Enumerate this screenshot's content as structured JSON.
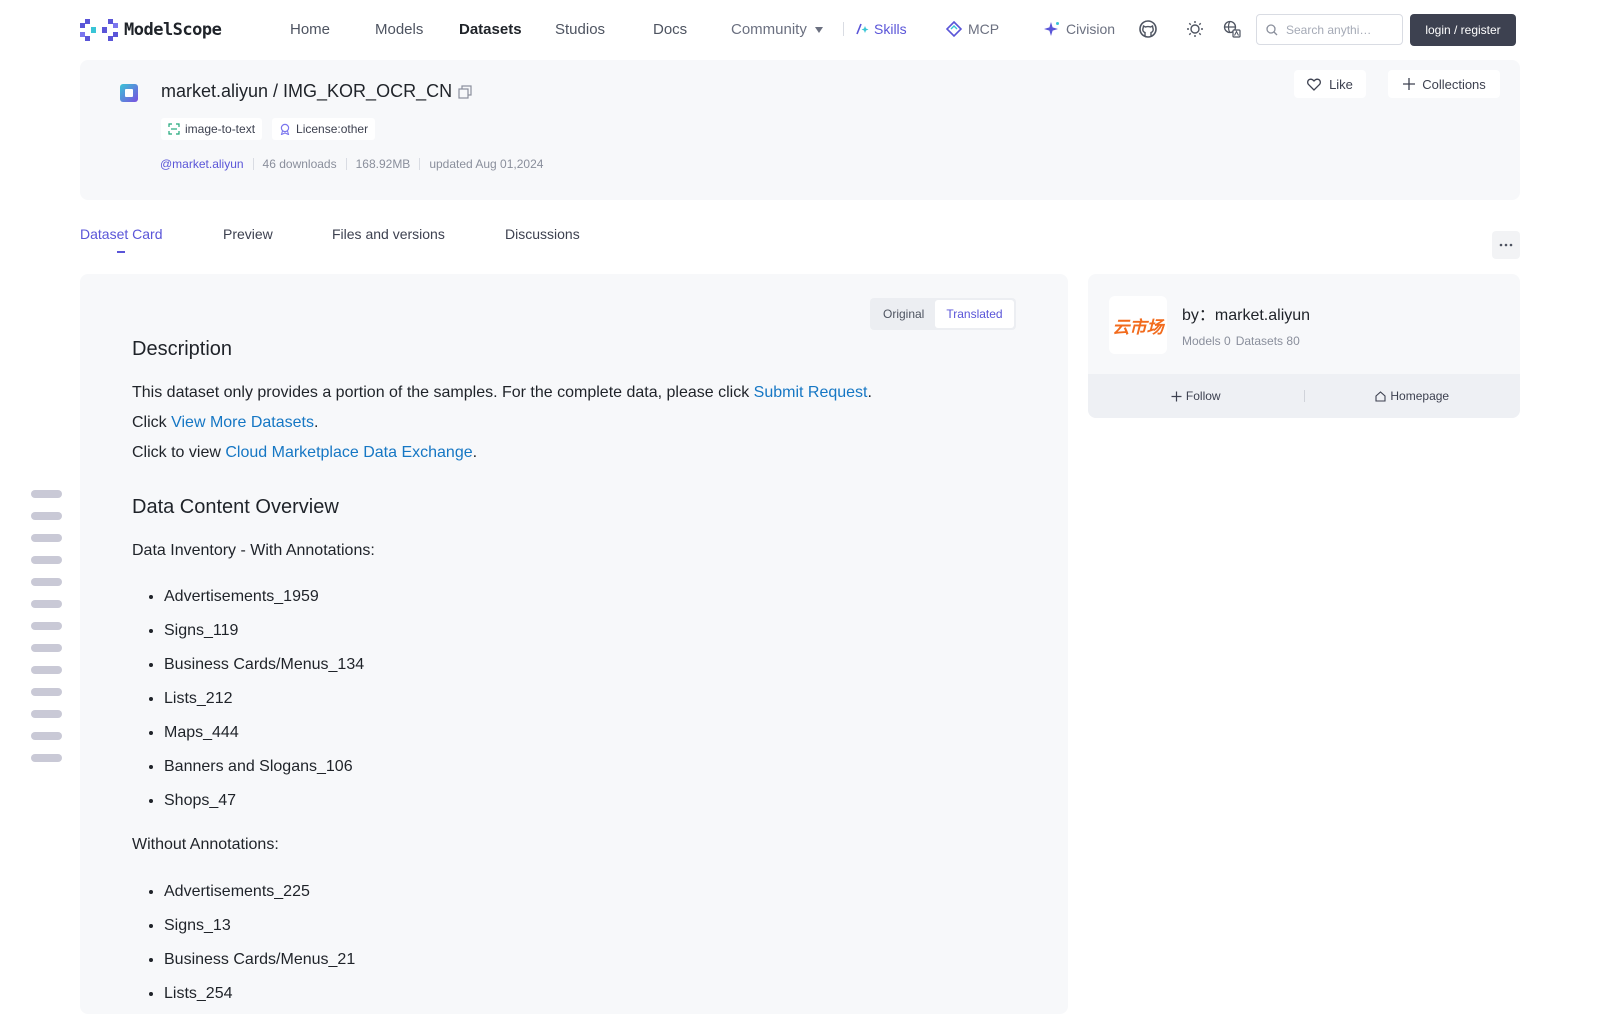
{
  "nav": {
    "logo_text": "ModelScope",
    "home": "Home",
    "models": "Models",
    "datasets": "Datasets",
    "studios": "Studios",
    "docs": "Docs",
    "community": "Community",
    "skills": "Skills",
    "mcp": "MCP",
    "civision": "Civision",
    "search_placeholder": "Search anythi…",
    "login": "login / register"
  },
  "dataset": {
    "title": "market.aliyun / IMG_KOR_OCR_CN",
    "tags": [
      "image-to-text",
      "License:other"
    ],
    "author": "@market.aliyun",
    "downloads": "46 downloads",
    "size": "168.92MB",
    "updated": "updated Aug 01,2024",
    "like": "Like",
    "collections": "Collections"
  },
  "tabs": [
    "Dataset Card",
    "Preview",
    "Files and versions",
    "Discussions"
  ],
  "lang_toggle": {
    "original": "Original",
    "translated": "Translated"
  },
  "card": {
    "description_heading": "Description",
    "p1_text": "This dataset only provides a portion of the samples. For the complete data, please click ",
    "p1_link": "Submit Request",
    "p2_text": "Click ",
    "p2_link": "View More Datasets",
    "p3_text": "Click to view ",
    "p3_link": "Cloud Marketplace Data Exchange",
    "period": ".",
    "overview_heading": "Data Content Overview",
    "with_annotations": "Data Inventory - With Annotations:",
    "with_items": [
      "Advertisements_1959",
      "Signs_119",
      "Business Cards/Menus_134",
      "Lists_212",
      "Maps_444",
      "Banners and Slogans_106",
      "Shops_47"
    ],
    "without_annotations": "Without Annotations:",
    "without_items": [
      "Advertisements_225",
      "Signs_13",
      "Business Cards/Menus_21",
      "Lists_254"
    ]
  },
  "author_card": {
    "logo_text": "云市场",
    "name": "by：market.aliyun",
    "models": "Models 0",
    "datasets": "Datasets 80",
    "follow": "Follow",
    "homepage": "Homepage"
  },
  "colors": {
    "accent": "#5a55d8",
    "link": "#1677c4",
    "login_bg": "#3d4150",
    "logo_orange": "#f26b1d"
  }
}
